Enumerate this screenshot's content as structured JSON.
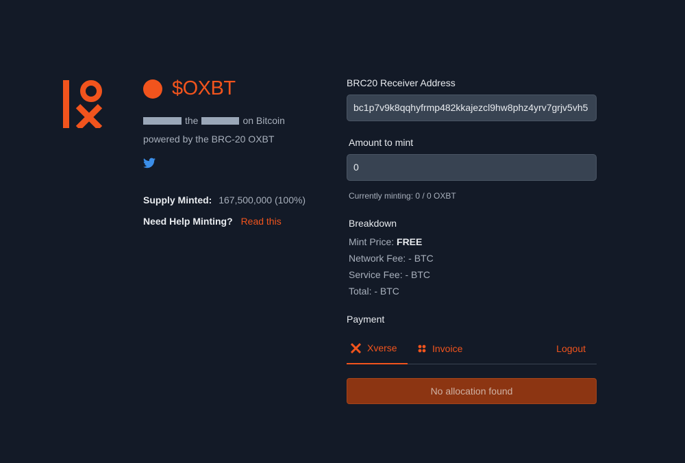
{
  "brand": {
    "accent": "#f1541d",
    "logo_text": "OX"
  },
  "token": {
    "name": "$OXBT",
    "tagline_mid": "the",
    "tagline_end": "on Bitcoin",
    "powered": "powered by the BRC-20 OXBT",
    "social_icon": "twitter-icon"
  },
  "stats": {
    "supply_label": "Supply Minted:",
    "supply_value": "167,500,000 (100%)",
    "help_label": "Need Help Minting?",
    "help_link": "Read this"
  },
  "form": {
    "receiver_label": "BRC20 Receiver Address",
    "receiver_value": "bc1p7v9k8qqhyfrmp482kkajezcl9hw8phz4yrv7grjv5vh5",
    "amount_label": "Amount to mint",
    "amount_value": "0",
    "currently_minting": "Currently minting: 0 / 0 OXBT"
  },
  "breakdown": {
    "title": "Breakdown",
    "mint_price_label": "Mint Price:",
    "mint_price_value": "FREE",
    "network_fee": "Network Fee: - BTC",
    "service_fee": "Service Fee: - BTC",
    "total": "Total: - BTC"
  },
  "payment": {
    "title": "Payment",
    "tabs": [
      {
        "label": "Xverse",
        "icon": "xverse-icon",
        "active": true
      },
      {
        "label": "Invoice",
        "icon": "dots-grid-icon",
        "active": false
      }
    ],
    "logout": "Logout",
    "status_button": "No allocation found"
  }
}
